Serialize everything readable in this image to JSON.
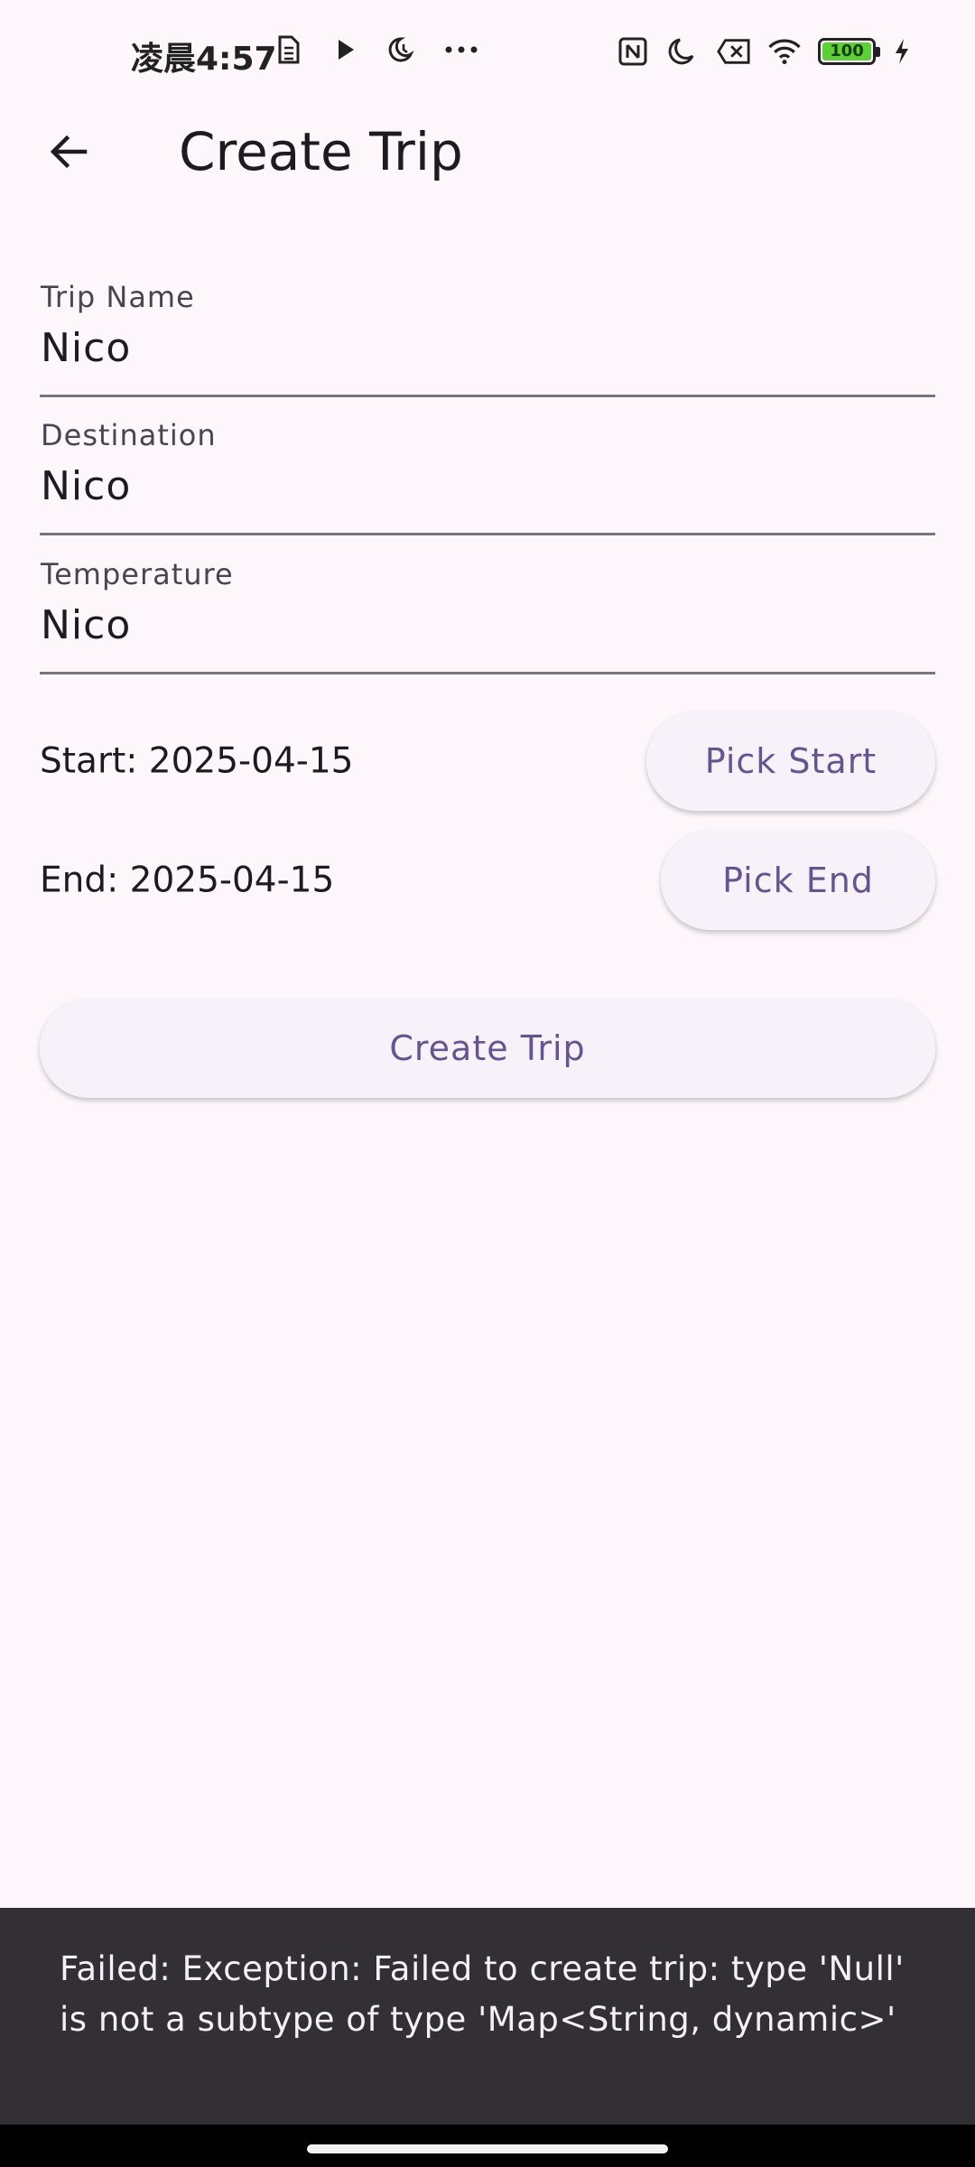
{
  "status_bar": {
    "time": "凌晨4:57",
    "battery_level": "100",
    "battery_fraction": 1.0,
    "left_icons": [
      "sim-icon",
      "play-icon",
      "moon-clock-icon",
      "more-dots-icon"
    ],
    "right_icons": [
      "nfc-icon",
      "moon-icon",
      "no-sim-icon",
      "wifi-icon",
      "battery-icon",
      "charging-icon"
    ]
  },
  "app_bar": {
    "title": "Create Trip",
    "back_icon": "arrow-left-icon"
  },
  "form": {
    "trip_name": {
      "label": "Trip Name",
      "value": "Nico"
    },
    "destination": {
      "label": "Destination",
      "value": "Nico"
    },
    "temperature": {
      "label": "Temperature",
      "value": "Nico"
    }
  },
  "dates": {
    "start_text": "Start: 2025-04-15",
    "pick_start_label": "Pick Start",
    "end_text": "End: 2025-04-15",
    "pick_end_label": "Pick End"
  },
  "create_button_label": "Create Trip",
  "snackbar": {
    "message": "Failed: Exception: Failed to create trip: type 'Null' is not a subtype of type 'Map<String, dynamic>'"
  },
  "colors": {
    "background": "#fdf7fc",
    "accent": "#65558f",
    "button_bg": "#f7f2fa",
    "snackbar_bg": "#322f35",
    "battery_green": "#5cd135"
  }
}
